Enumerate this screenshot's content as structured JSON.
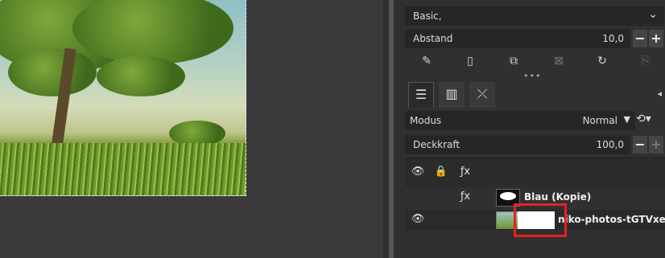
{
  "brushes": {
    "preset": "Basic,"
  },
  "spacing": {
    "label": "Abstand",
    "value": "10,0"
  },
  "layers_panel": {
    "mode_label": "Modus",
    "mode_value": "Normal",
    "opacity_label": "Deckkraft",
    "opacity_value": "100,0",
    "layers": [
      {
        "name": "Blau (Kopie)"
      },
      {
        "name": "niko-photos-tGTVxeOr_R"
      }
    ]
  },
  "icons": {
    "toolbar": [
      "edit-icon",
      "new-doc-icon",
      "duplicate-icon",
      "delete-icon",
      "refresh-icon",
      "export-icon"
    ],
    "tabs": [
      "layers-icon",
      "channels-icon",
      "paths-icon"
    ]
  },
  "colors": {
    "highlight": "#e8211d",
    "panel_bg": "#303030"
  }
}
